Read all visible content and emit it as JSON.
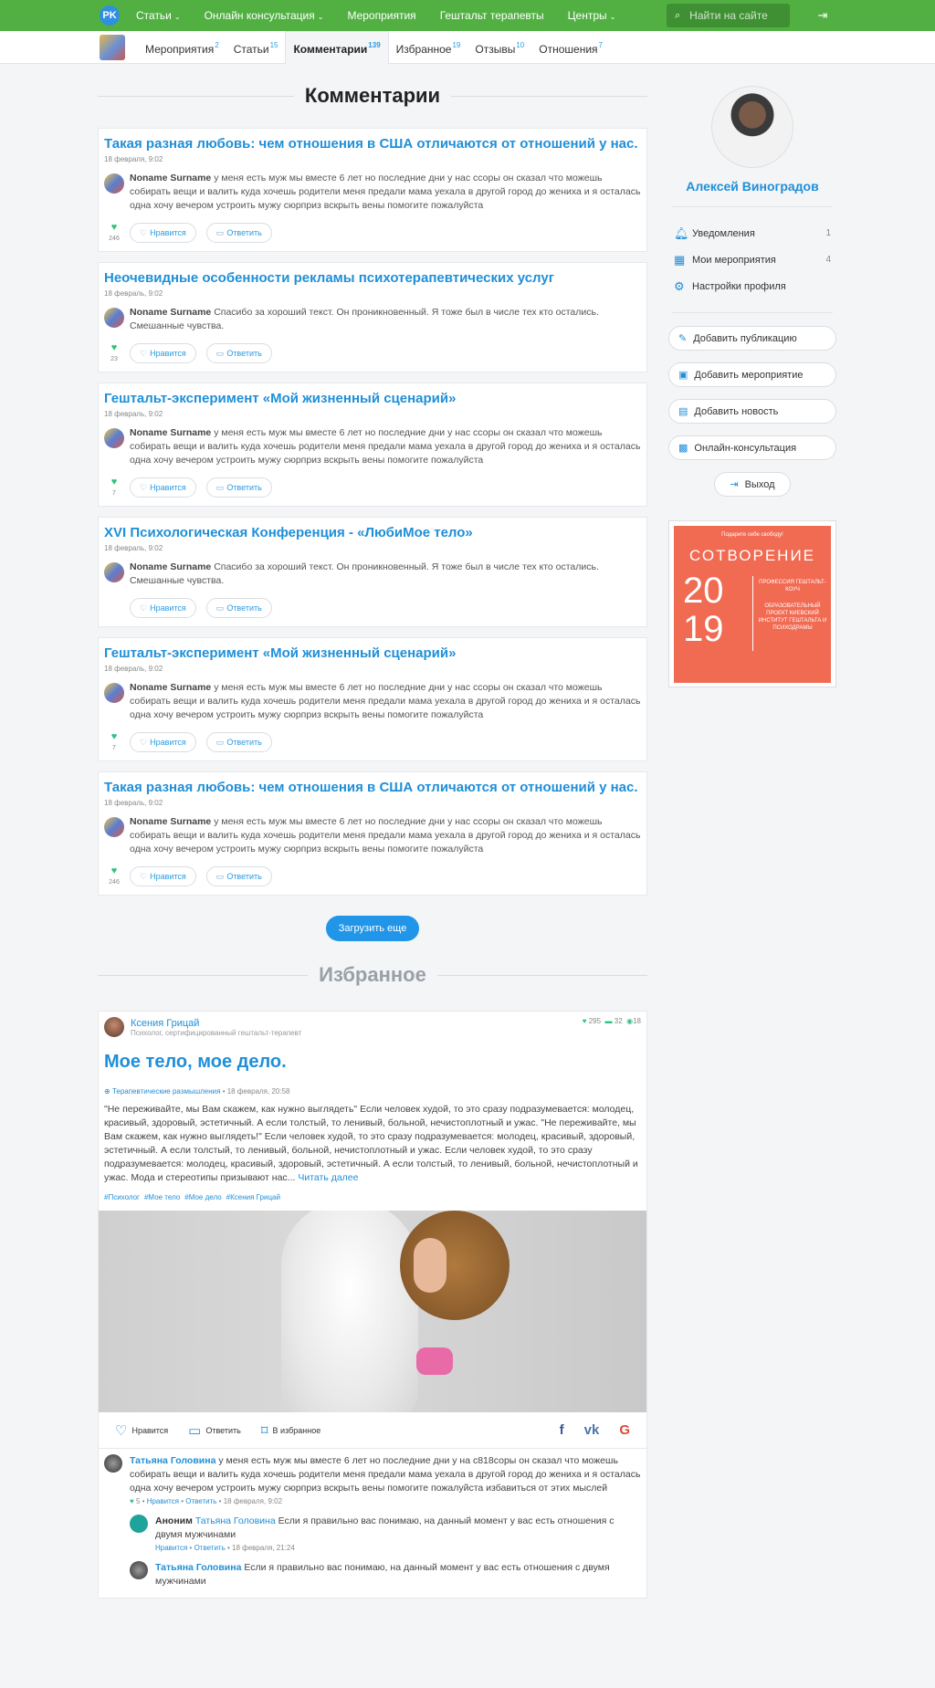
{
  "nav": {
    "logo": "PK",
    "links": [
      {
        "label": "Статьи",
        "dropdown": true
      },
      {
        "label": "Онлайн консультация",
        "dropdown": true
      },
      {
        "label": "Мероприятия",
        "dropdown": false
      },
      {
        "label": "Гештальт терапевты",
        "dropdown": false
      },
      {
        "label": "Центры",
        "dropdown": true
      }
    ],
    "search_placeholder": "Найти на сайте"
  },
  "subnav": {
    "tabs": [
      {
        "label": "Мероприятия",
        "count": "2"
      },
      {
        "label": "Статьи",
        "count": "15"
      },
      {
        "label": "Комментарии",
        "count": "139",
        "active": true
      },
      {
        "label": "Избранное",
        "count": "19"
      },
      {
        "label": "Отзывы",
        "count": "10"
      },
      {
        "label": "Отношения",
        "count": "7"
      }
    ]
  },
  "comments_section": {
    "title": "Комментарии",
    "like_label": "Нравится",
    "reply_label": "Ответить",
    "cards": [
      {
        "title": "Такая разная любовь: чем отношения в США отличаются от отношений у нас.",
        "date": "18 февраля, 9:02",
        "author": "Noname Surname",
        "text": "у меня есть муж мы вместе 6 лет но последние дни у нас ссоры  он сказал что можешь собирать вещи и валить куда хочешь родители меня предали мама уехала в другой город до жениха и я осталась одна хочу вечером устроить мужу сюрприз вскрыть вены помогите пожалуйста",
        "likes": "246"
      },
      {
        "title": "Неочевидные особенности рекламы психотерапевтических услуг",
        "date": "18 февраль, 9:02",
        "author": "Noname Surname",
        "text": "Спасибо за хороший текст. Он проникновенный. Я тоже был в числе тех кто остались. Смешанные чувства.",
        "likes": "23"
      },
      {
        "title": "Гештальт-эксперимент «Мой жизненный сценарий»",
        "date": "18 февраль, 9:02",
        "author": "Noname Surname",
        "text": "у меня есть муж мы вместе 6 лет но последние дни у нас ссоры  он сказал что можешь собирать вещи и валить куда хочешь родители меня предали мама уехала в другой город до жениха и я осталась одна хочу вечером устроить мужу сюрприз вскрыть вены помогите пожалуйста",
        "likes": "7"
      },
      {
        "title": "XVI Психологическая Конференция - «ЛюбиМое тело»",
        "date": "18 февраль, 9:02",
        "author": "Noname Surname",
        "text": "Спасибо за хороший текст. Он проникновенный. Я тоже был в числе тех кто остались. Смешанные чувства.",
        "likes": ""
      },
      {
        "title": "Гештальт-эксперимент «Мой жизненный сценарий»",
        "date": "18 февраль, 9:02",
        "author": "Noname Surname",
        "text": "у меня есть муж мы вместе 6 лет но последние дни у нас ссоры  он сказал что можешь собирать вещи и валить куда хочешь родители меня предали мама уехала в другой город до жениха и я осталась одна хочу вечером устроить мужу сюрприз вскрыть вены помогите пожалуйста",
        "likes": "7"
      },
      {
        "title": "Такая разная любовь: чем отношения в США отличаются от отношений у нас.",
        "date": "18 февраль, 9:02",
        "author": "Noname Surname",
        "text": "у меня есть муж мы вместе 6 лет но последние дни у нас ссоры  он сказал что можешь собирать вещи и валить куда хочешь родители меня предали мама уехала в другой город до жениха и я осталась одна хочу вечером устроить мужу сюрприз вскрыть вены помогите пожалуйста",
        "likes": "246"
      }
    ],
    "load_more": "Загрузить еще"
  },
  "favorites_section": {
    "title": "Избранное",
    "article": {
      "author": "Ксения Грицай",
      "role": "Психолог, сертифицированный гештальт-терапевт",
      "stats": {
        "likes": "295",
        "comments": "32",
        "views": "18"
      },
      "title": "Мое тело, мое дело.",
      "category": "Терапевтические размышления",
      "date": "• 18 февраля, 20:58",
      "body": "\"Не переживайте, мы Вам скажем, как нужно выглядеть\" Если человек худой, то это сразу подразумевается: молодец, красивый, здоровый, эстетичный. А если толстый, то ленивый, больной, нечистоплотный и ужас. \"Не переживайте, мы Вам скажем, как нужно выглядеть!\" Если человек худой, то это сразу подразумевается: молодец, красивый, здоровый, эстетичный. А если толстый, то ленивый, больной, нечистоплотный и ужас. Если человек худой, то это сразу подразумевается: молодец, красивый, здоровый, эстетичный. А если толстый, то ленивый, больной, нечистоплотный и ужас. Мода и стереотипы призывают нас...",
      "read_more": "Читать далее",
      "tags": [
        "#Психолог",
        "#Мое тело",
        "#Мое дело",
        "#Ксения Грицай"
      ],
      "share": {
        "like": "Нравится",
        "reply": "Ответить",
        "fav": "В избранное"
      },
      "comments": [
        {
          "author": "Татьяна Головина",
          "text": "у меня есть муж мы вместе 6 лет но последние дни у на с818соры  он сказал что можешь собирать вещи и валить куда хочешь родители меня предали мама уехала в другой город до жениха и я осталась одна хочу вечером устроить мужу сюрприз вскрыть вены помогите пожалуйста избавиться от этих мыслей",
          "likes": "5",
          "like": "Нравится",
          "reply": "Ответить",
          "date": "18 февраля, 9:02"
        },
        {
          "author": "Аноним",
          "to": "Татьяна Головина",
          "text": "Если я правильно вас понимаю, на данный момент у вас есть отношения с двумя мужчинами",
          "like": "Нравится",
          "reply": "Ответить",
          "date": "18 февраля, 21:24"
        },
        {
          "author": "Татьяна Головина",
          "text": "Если я правильно вас понимаю, на данный момент у вас есть отношения с двумя мужчинами"
        }
      ]
    }
  },
  "profile": {
    "name": "Алексей Виноградов",
    "menu": [
      {
        "label": "Уведомления",
        "count": "1",
        "icon": "bell-icon"
      },
      {
        "label": "Мои мероприятия",
        "count": "4",
        "icon": "calendar-icon"
      },
      {
        "label": "Настройки профиля",
        "count": "",
        "icon": "gear-icon"
      }
    ],
    "buttons": [
      "Добавить публикацию",
      "Добавить мероприятие",
      "Добавить новость",
      "Онлайн-консультация"
    ],
    "logout": "Выход",
    "ad": {
      "top": "Подарите себе свободу!",
      "brand": "СОТВОРЕНИЕ",
      "year": "20 19",
      "line1": "ПРОФЕССИЯ ГЕШТАЛЬТ-КОУЧ",
      "line2": "ОБРАЗОВАТЕЛЬНЫЙ ПРОЕКТ КИЕВСКИЙ ИНСТИТУТ ГЕШТАЛЬТА И ПСИХОДРАМЫ"
    }
  },
  "colors": {
    "nav": "#52b043",
    "accent": "#1f8fd8",
    "like": "#2ec27e",
    "ad": "#f16a52"
  }
}
